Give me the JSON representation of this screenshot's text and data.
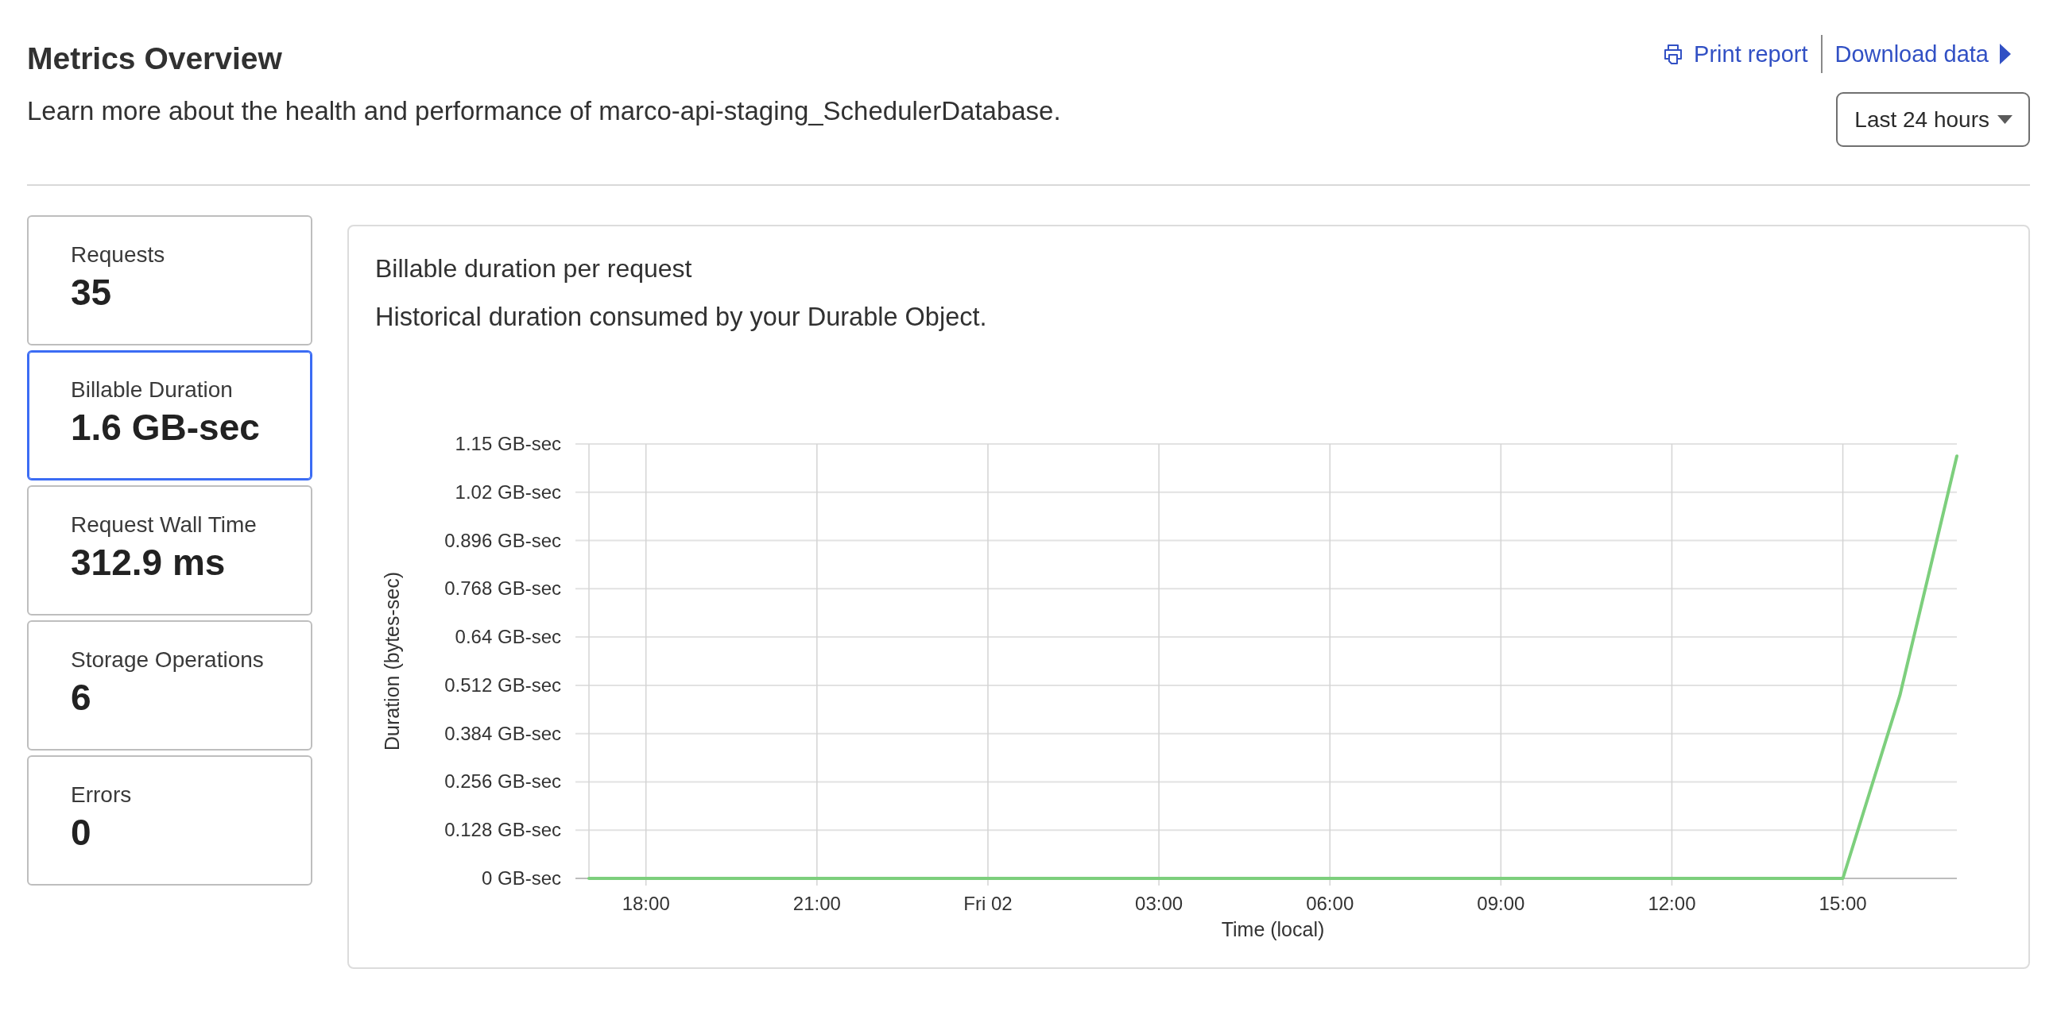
{
  "header": {
    "title": "Metrics Overview",
    "description": "Learn more about the health and performance of marco-api-staging_SchedulerDatabase.",
    "actions": [
      {
        "kind": "print",
        "label": "Print report"
      },
      {
        "kind": "download",
        "label": "Download data"
      }
    ],
    "range": {
      "value": "Last 24 hours"
    }
  },
  "metrics": [
    {
      "label": "Requests",
      "value": "35",
      "selected": false
    },
    {
      "label": "Billable Duration",
      "value": "1.6 GB-sec",
      "selected": true
    },
    {
      "label": "Request Wall Time",
      "value": "312.9 ms",
      "selected": false
    },
    {
      "label": "Storage Operations",
      "value": "6",
      "selected": false
    },
    {
      "label": "Errors",
      "value": "0",
      "selected": false
    }
  ],
  "chart_card": {
    "title": "Billable duration per request",
    "description": "Historical duration consumed by your Durable Object.",
    "chart_data": {
      "type": "line",
      "xlabel": "Time (local)",
      "ylabel": "Duration (bytes-sec)",
      "grid": true,
      "categories": [
        null,
        "18:00",
        null,
        null,
        "21:00",
        null,
        null,
        "Fri 02",
        null,
        null,
        "03:00",
        null,
        null,
        "06:00",
        null,
        null,
        "09:00",
        null,
        null,
        "12:00",
        null,
        null,
        "15:00",
        null,
        null
      ],
      "series": [
        {
          "color": "#7dcf7d",
          "values": [
            0,
            0,
            0,
            0,
            0,
            0,
            0,
            0,
            0,
            0,
            0,
            0,
            0,
            0,
            0,
            0,
            0,
            0,
            0,
            0,
            0,
            0,
            0,
            0.485,
            1.12
          ]
        }
      ],
      "ylim": [
        0,
        1.152
      ],
      "yticks": [
        {
          "value": 0,
          "label": "0 GB-sec"
        },
        {
          "value": 0.128,
          "label": "0.128 GB-sec"
        },
        {
          "value": 0.256,
          "label": "0.256 GB-sec"
        },
        {
          "value": 0.384,
          "label": "0.384 GB-sec"
        },
        {
          "value": 0.512,
          "label": "0.512 GB-sec"
        },
        {
          "value": 0.64,
          "label": "0.64 GB-sec"
        },
        {
          "value": 0.768,
          "label": "0.768 GB-sec"
        },
        {
          "value": 0.896,
          "label": "0.896 GB-sec"
        },
        {
          "value": 1.024,
          "label": "1.02 GB-sec"
        },
        {
          "value": 1.152,
          "label": "1.15 GB-sec"
        }
      ]
    }
  }
}
